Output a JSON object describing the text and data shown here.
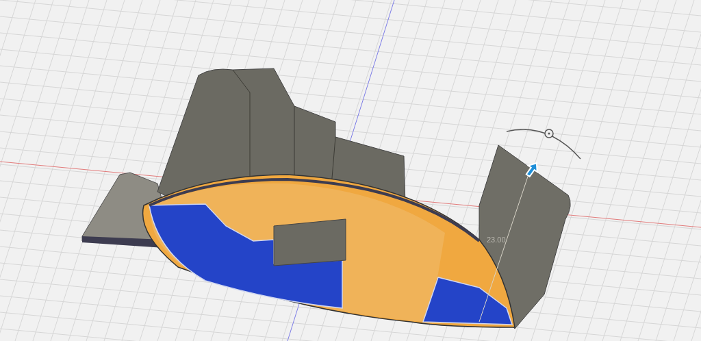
{
  "viewport": {
    "dimension_label": "23.00"
  }
}
